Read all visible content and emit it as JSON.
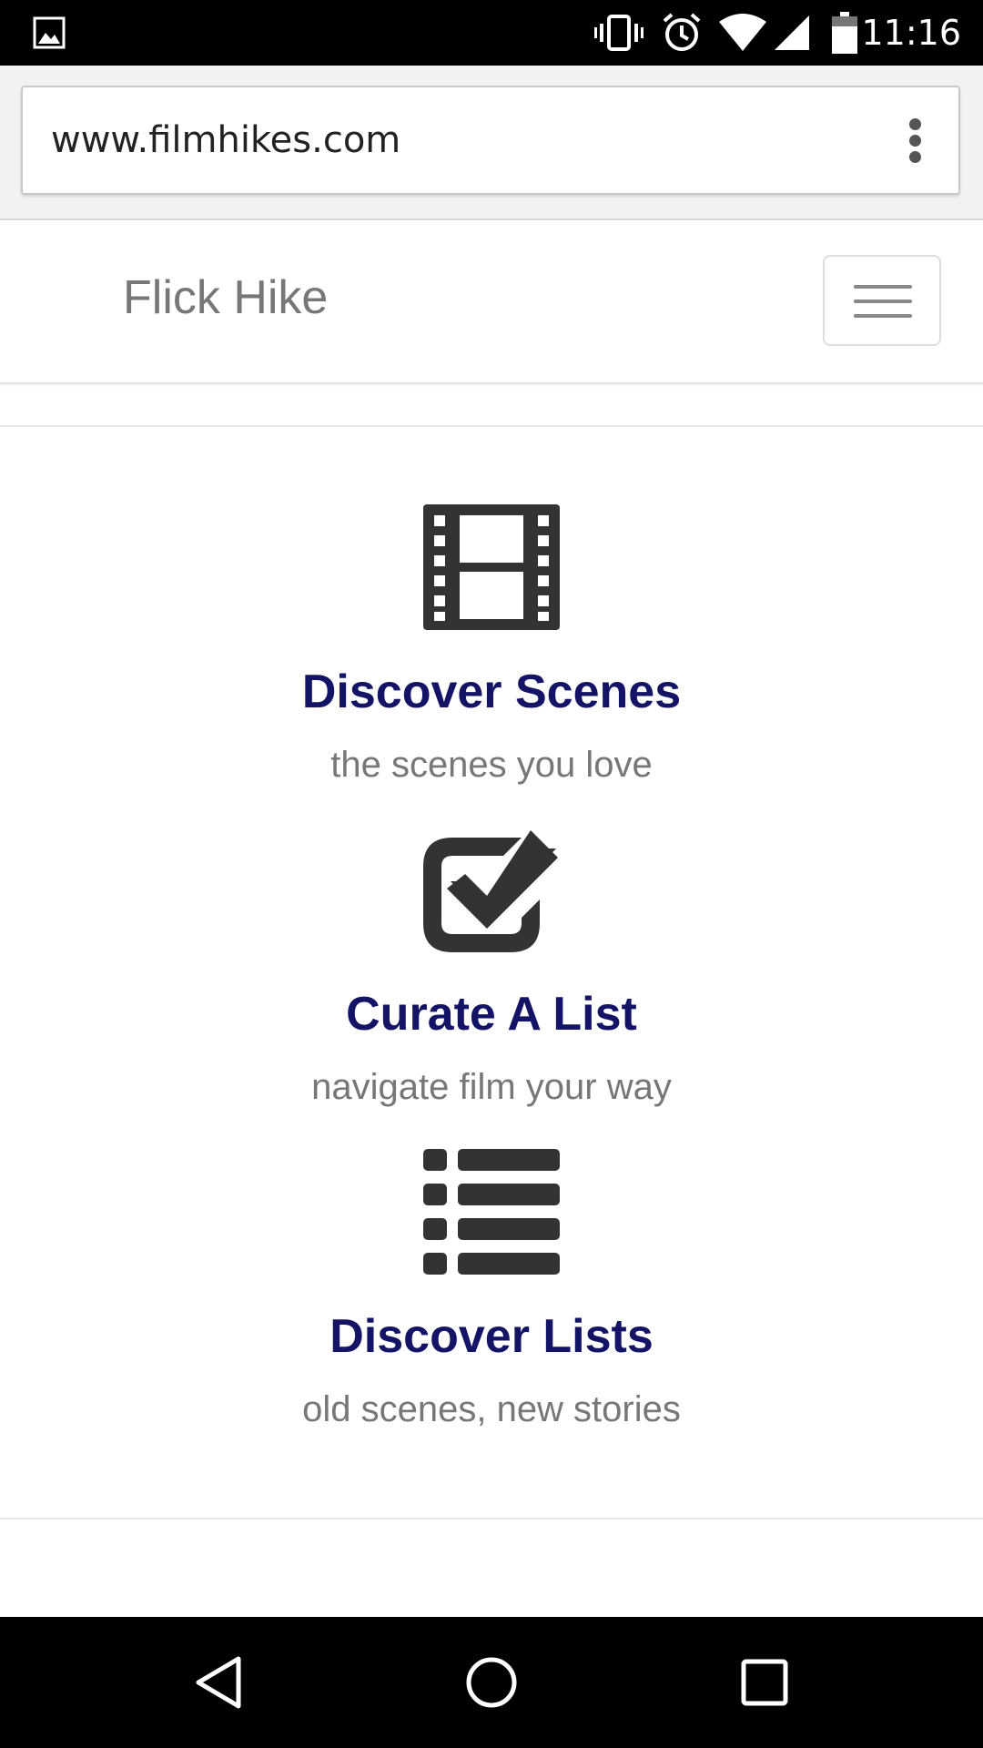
{
  "status_bar": {
    "time": "11:16",
    "icons": [
      "image-icon",
      "vibrate-icon",
      "alarm-icon",
      "wifi-icon",
      "cell-signal-icon",
      "battery-icon"
    ]
  },
  "browser": {
    "url": "www.filmhikes.com",
    "menu_icon": "more-vert-icon"
  },
  "navbar": {
    "brand": "Flick Hike",
    "toggle_icon": "hamburger-icon"
  },
  "features": [
    {
      "icon": "film-icon",
      "title": "Discover Scenes",
      "subtitle": "the scenes you love"
    },
    {
      "icon": "check-square-icon",
      "title": "Curate A List",
      "subtitle": "navigate film your way"
    },
    {
      "icon": "list-icon",
      "title": "Discover Lists",
      "subtitle": "old scenes, new stories"
    }
  ],
  "system_nav": {
    "buttons": [
      "back-icon",
      "home-icon",
      "recents-icon"
    ]
  },
  "colors": {
    "title": "#141466",
    "subtitle": "#777777",
    "icon": "#333333",
    "brand": "#777777"
  }
}
